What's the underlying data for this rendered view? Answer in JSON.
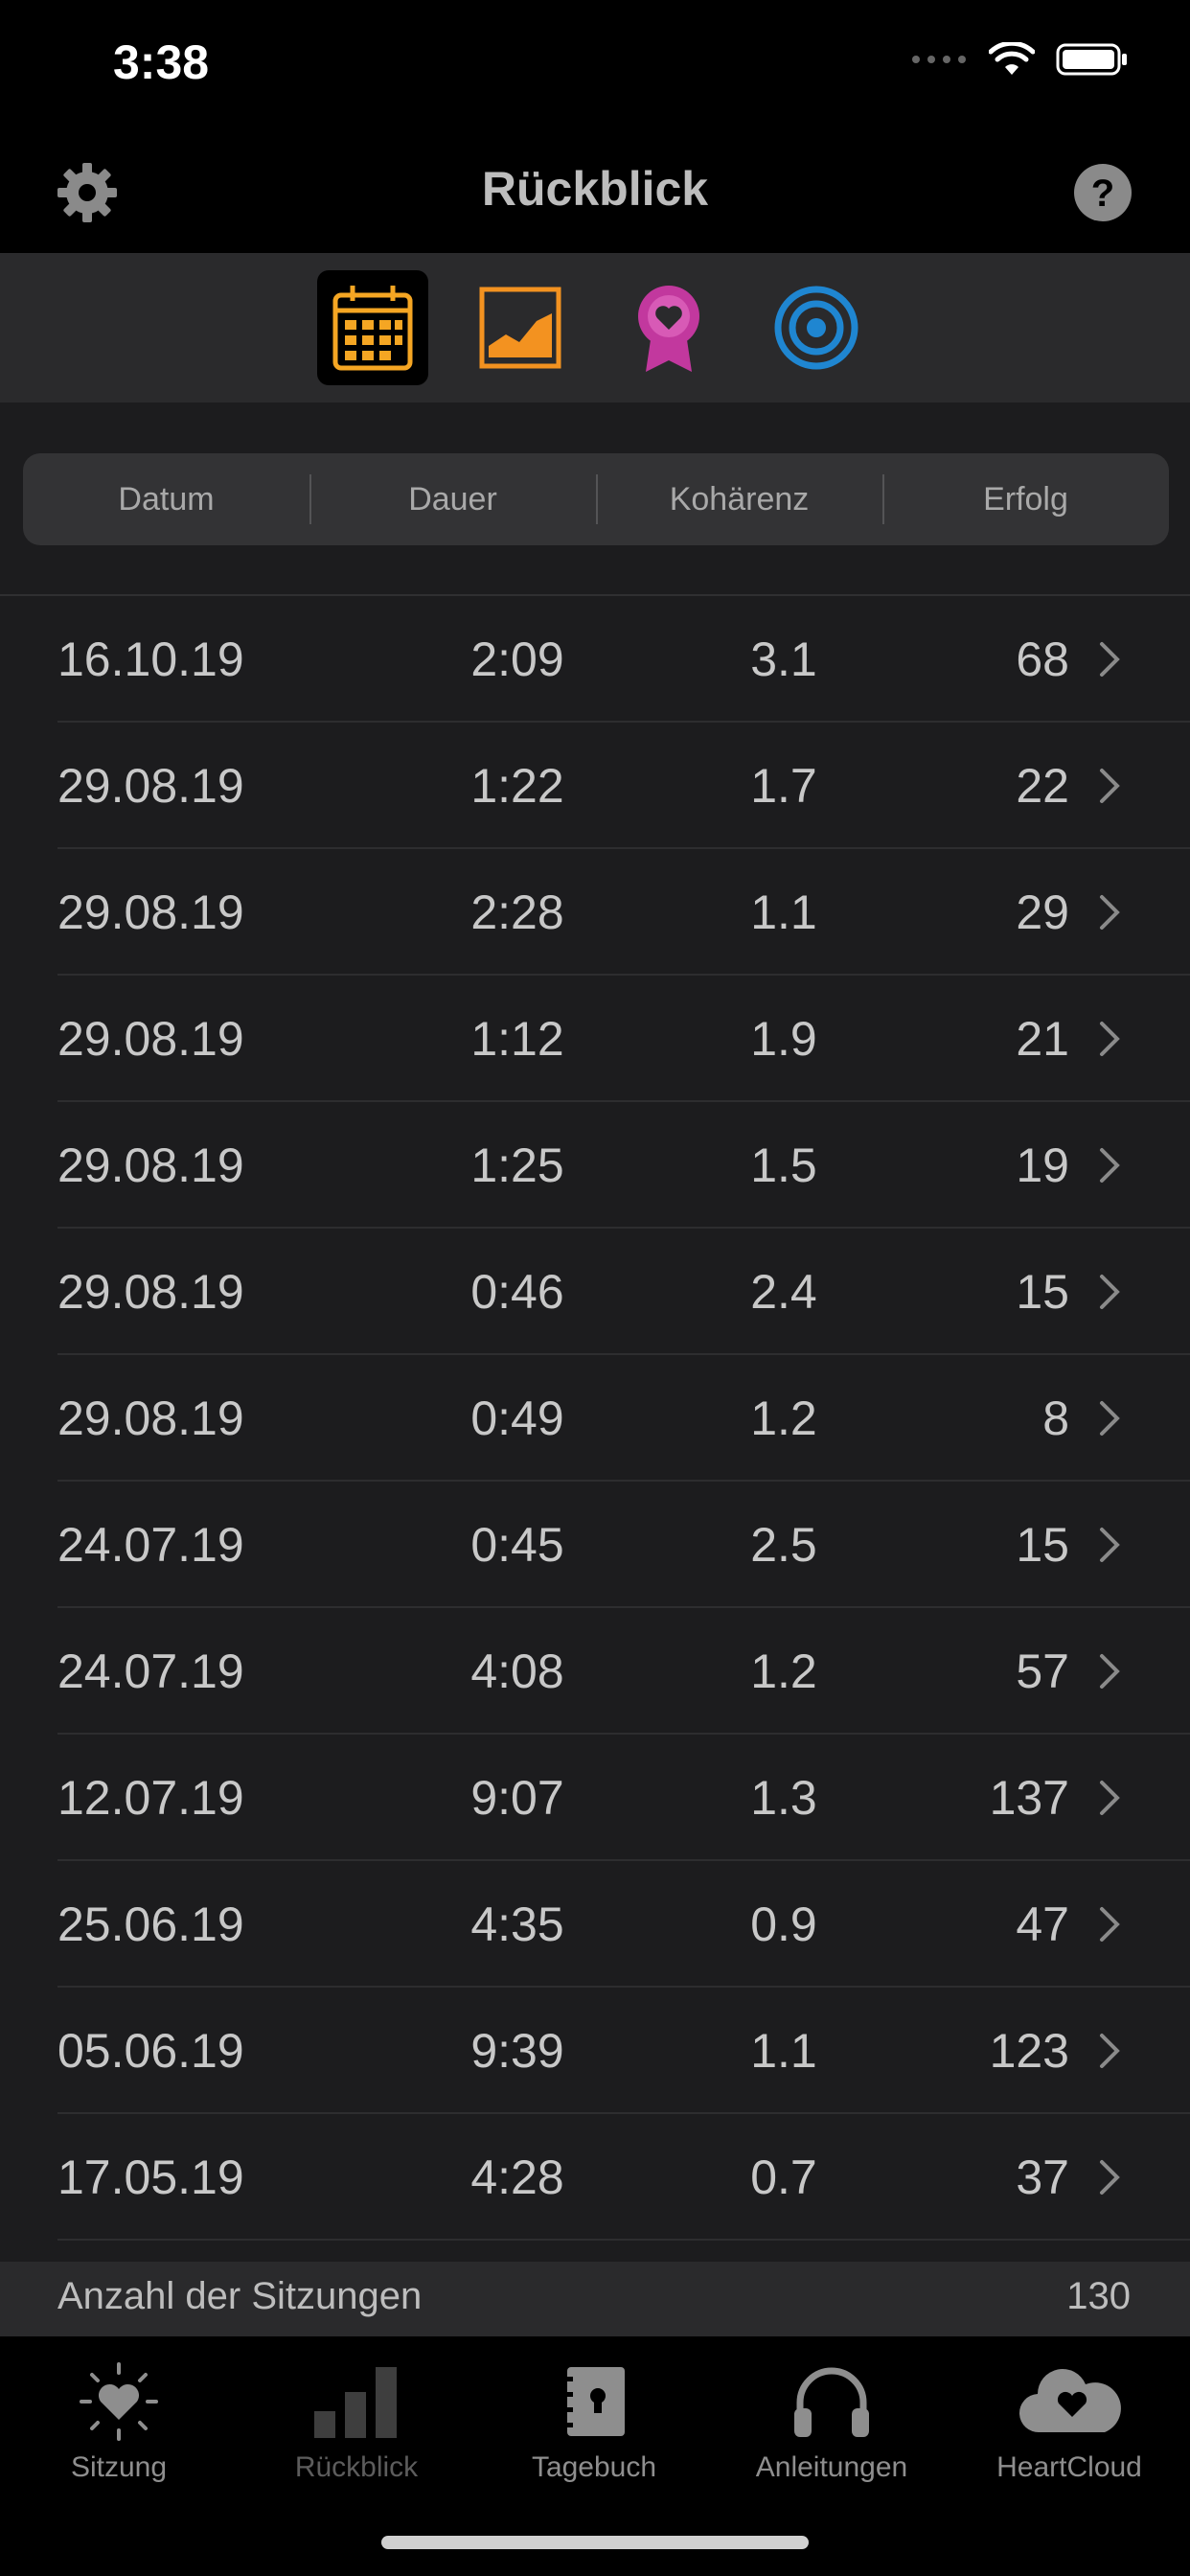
{
  "status_bar": {
    "time": "3:38"
  },
  "nav": {
    "title": "Rückblick",
    "left_icon": "gear-icon",
    "right_icon": "help-icon"
  },
  "segments": [
    {
      "icon": "calendar-icon",
      "color": "#f5a623",
      "active": true
    },
    {
      "icon": "chart-icon",
      "color": "#f39220",
      "active": false
    },
    {
      "icon": "award-heart-icon",
      "color": "#c2389e",
      "active": false
    },
    {
      "icon": "target-icon",
      "color": "#1f86d1",
      "active": false
    }
  ],
  "table": {
    "columns": [
      "Datum",
      "Dauer",
      "Kohärenz",
      "Erfolg"
    ],
    "rows": [
      {
        "date": "16.10.19",
        "duration": "2:09",
        "coherence": "3.1",
        "success": "68"
      },
      {
        "date": "29.08.19",
        "duration": "1:22",
        "coherence": "1.7",
        "success": "22"
      },
      {
        "date": "29.08.19",
        "duration": "2:28",
        "coherence": "1.1",
        "success": "29"
      },
      {
        "date": "29.08.19",
        "duration": "1:12",
        "coherence": "1.9",
        "success": "21"
      },
      {
        "date": "29.08.19",
        "duration": "1:25",
        "coherence": "1.5",
        "success": "19"
      },
      {
        "date": "29.08.19",
        "duration": "0:46",
        "coherence": "2.4",
        "success": "15"
      },
      {
        "date": "29.08.19",
        "duration": "0:49",
        "coherence": "1.2",
        "success": "8"
      },
      {
        "date": "24.07.19",
        "duration": "0:45",
        "coherence": "2.5",
        "success": "15"
      },
      {
        "date": "24.07.19",
        "duration": "4:08",
        "coherence": "1.2",
        "success": "57"
      },
      {
        "date": "12.07.19",
        "duration": "9:07",
        "coherence": "1.3",
        "success": "137"
      },
      {
        "date": "25.06.19",
        "duration": "4:35",
        "coherence": "0.9",
        "success": "47"
      },
      {
        "date": "05.06.19",
        "duration": "9:39",
        "coherence": "1.1",
        "success": "123"
      },
      {
        "date": "17.05.19",
        "duration": "4:28",
        "coherence": "0.7",
        "success": "37"
      }
    ]
  },
  "footer": {
    "label": "Anzahl der Sitzungen",
    "value": "130"
  },
  "tabs": [
    {
      "label": "Sitzung",
      "icon": "heart-sun-icon"
    },
    {
      "label": "Rückblick",
      "icon": "bars-icon"
    },
    {
      "label": "Tagebuch",
      "icon": "journal-icon"
    },
    {
      "label": "Anleitungen",
      "icon": "headphones-icon"
    },
    {
      "label": "HeartCloud",
      "icon": "cloud-heart-icon"
    }
  ]
}
